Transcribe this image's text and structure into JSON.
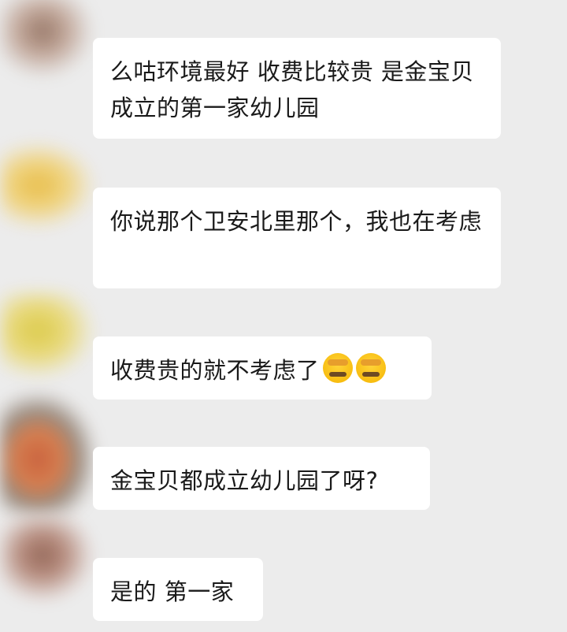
{
  "messages": [
    {
      "text": "么咕环境最好 收费比较贵 是金宝贝成立的第一家幼儿园"
    },
    {
      "text": "你说那个卫安北里那个，我也在考虑"
    },
    {
      "text": "收费贵的就不考虑了",
      "emojis": [
        "face-with-hand-over-mouth-icon",
        "face-with-hand-over-mouth-icon"
      ]
    },
    {
      "text": "金宝贝都成立幼儿园了呀?"
    },
    {
      "text": "是的 第一家"
    }
  ],
  "colors": {
    "background": "#ececec",
    "bubble": "#ffffff",
    "text": "#1a1a1a"
  }
}
